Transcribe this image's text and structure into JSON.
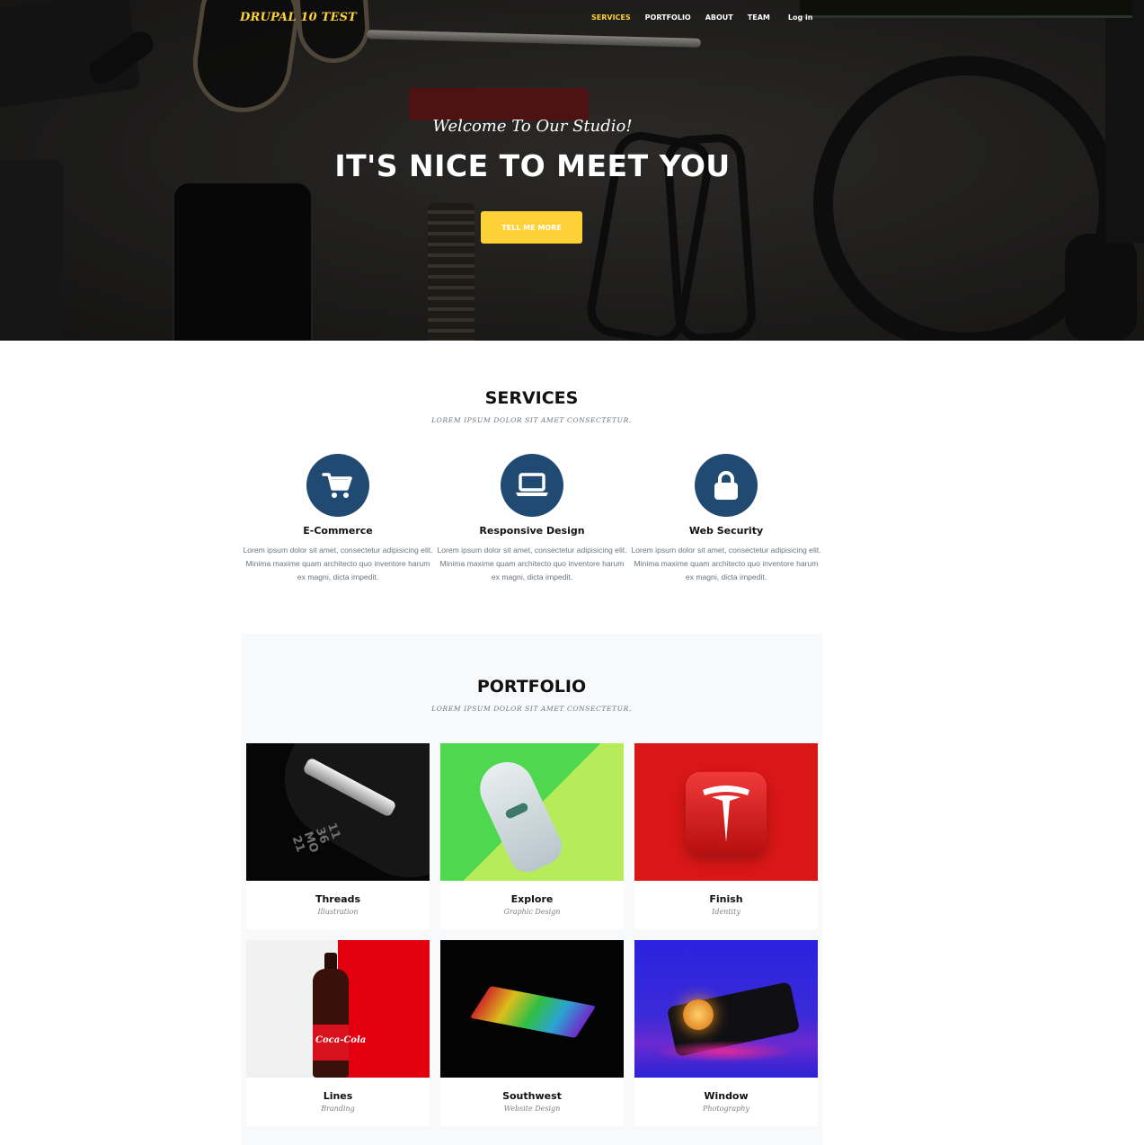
{
  "brand": "DRUPAL 10 TEST",
  "nav": {
    "items": [
      {
        "label": "SERVICES",
        "active": true
      },
      {
        "label": "PORTFOLIO"
      },
      {
        "label": "ABOUT"
      },
      {
        "label": "TEAM"
      }
    ],
    "login": "Log in"
  },
  "hero": {
    "subheading": "Welcome To Our Studio!",
    "heading": "IT'S NICE TO MEET YOU",
    "button": "TELL ME MORE"
  },
  "services": {
    "heading": "SERVICES",
    "subheading": "LOREM IPSUM DOLOR SIT AMET CONSECTETUR.",
    "items": [
      {
        "icon": "shopping-cart-icon",
        "title": "E-Commerce",
        "text": "Lorem ipsum dolor sit amet, consectetur adipisicing elit. Minima maxime quam architecto quo inventore harum ex magni, dicta impedit."
      },
      {
        "icon": "laptop-icon",
        "title": "Responsive Design",
        "text": "Lorem ipsum dolor sit amet, consectetur adipisicing elit. Minima maxime quam architecto quo inventore harum ex magni, dicta impedit."
      },
      {
        "icon": "lock-icon",
        "title": "Web Security",
        "text": "Lorem ipsum dolor sit amet, consectetur adipisicing elit. Minima maxime quam architecto quo inventore harum ex magni, dicta impedit."
      }
    ]
  },
  "portfolio": {
    "heading": "PORTFOLIO",
    "subheading": "LOREM IPSUM DOLOR SIT AMET CONSECTETUR.",
    "items": [
      {
        "title": "Threads",
        "category": "Illustration",
        "image": "fitness-band-photo"
      },
      {
        "title": "Explore",
        "category": "Graphic Design",
        "image": "sneaker-photo"
      },
      {
        "title": "Finish",
        "category": "Identity",
        "image": "tesla-logo-photo"
      },
      {
        "title": "Lines",
        "category": "Branding",
        "image": "coca-cola-bottle-photo"
      },
      {
        "title": "Southwest",
        "category": "Website Design",
        "image": "rgb-keyboard-photo"
      },
      {
        "title": "Window",
        "category": "Photography",
        "image": "chanel-lighter-photo"
      }
    ]
  },
  "colors": {
    "accent": "#fed136",
    "icon_circle": "#214a72",
    "portfolio_bg": "#f8f9fa"
  }
}
